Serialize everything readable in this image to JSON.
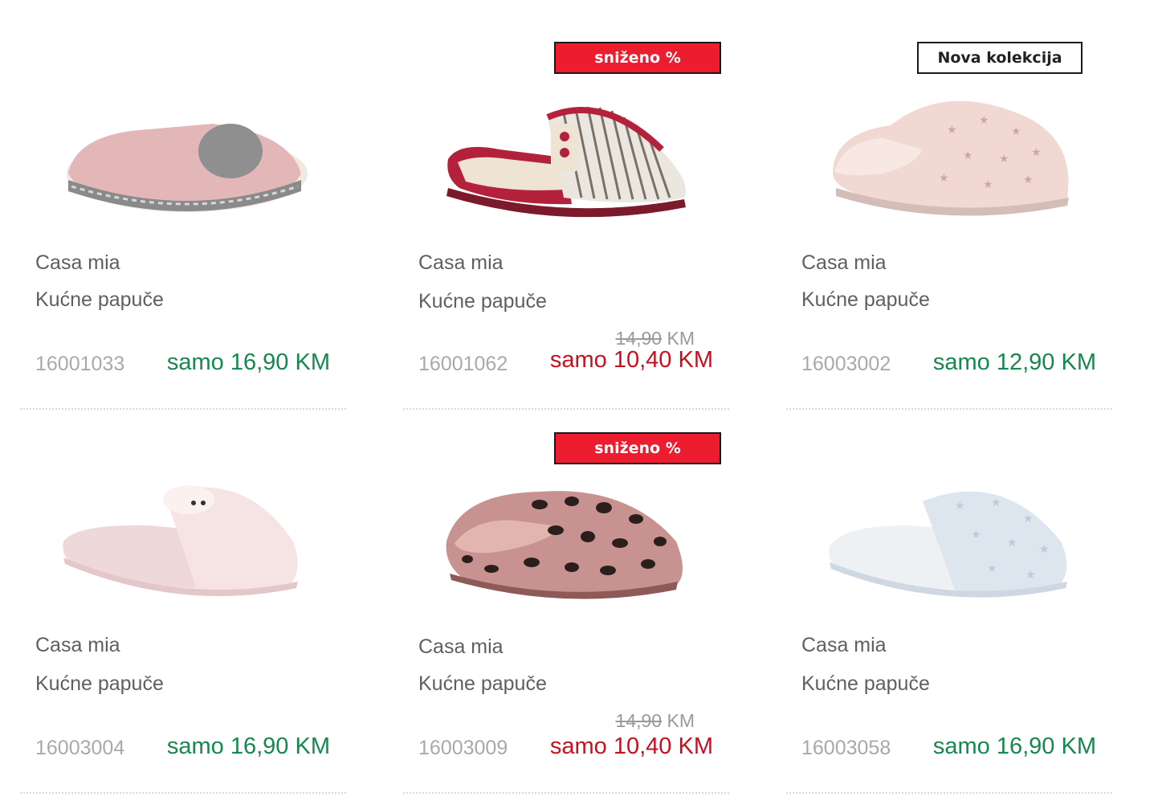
{
  "products": [
    {
      "brand": "Casa mia",
      "name": "Kućne papuče",
      "sku": "16001033",
      "price": "samo 16,90 KM",
      "shoe_icon": "pink-knit-slipper-with-grey-heart",
      "colors": {
        "upper": "#e3b6b8",
        "sole": "#8a8a8a",
        "accent": "#8f8f8f"
      }
    },
    {
      "brand": "Casa mia",
      "name": "Kućne papuče",
      "sku": "16001062",
      "old_price_value": "14,90",
      "old_price_unit": "KM",
      "price": "samo 10,40 KM",
      "badge": "sniženo %",
      "shoe_icon": "red-striped-slipper",
      "colors": {
        "upper": "#ebe6df",
        "sole": "#b3223a",
        "accent": "#7a7065"
      }
    },
    {
      "brand": "Casa mia",
      "name": "Kućne papuče",
      "sku": "16003002",
      "price": "samo 12,90 KM",
      "badge_new": "Nova kolekcija",
      "shoe_icon": "pink-plush-star-slipper",
      "colors": {
        "upper": "#f1d8d3",
        "sole": "#d4bcb7",
        "accent": "#c9a9a3"
      }
    },
    {
      "brand": "Casa mia",
      "name": "Kućne papuče",
      "sku": "16003004",
      "price": "samo 16,90 KM",
      "shoe_icon": "light-pink-plush-slipper",
      "colors": {
        "upper": "#f6e4e4",
        "sole": "#efd8da",
        "accent": "#e3c7c9"
      }
    },
    {
      "brand": "Casa mia",
      "name": "Kućne papuče",
      "sku": "16003009",
      "old_price_value": "14,90",
      "old_price_unit": "KM",
      "price": "samo 10,40 KM",
      "badge": "sniženo %",
      "shoe_icon": "leopard-print-slipper",
      "colors": {
        "upper": "#c7928f",
        "sole": "#8e5a58",
        "accent": "#2b1f1e"
      }
    },
    {
      "brand": "Casa mia",
      "name": "Kućne papuče",
      "sku": "16003058",
      "price": "samo 16,90 KM",
      "shoe_icon": "light-blue-star-slipper",
      "colors": {
        "upper": "#dde5ef",
        "sole": "#cfd8e2",
        "accent": "#c0cad6"
      }
    }
  ],
  "colors": {
    "price_regular": "#17874f",
    "price_sale": "#c5101f",
    "badge_sale_bg": "#ed1c2e"
  }
}
